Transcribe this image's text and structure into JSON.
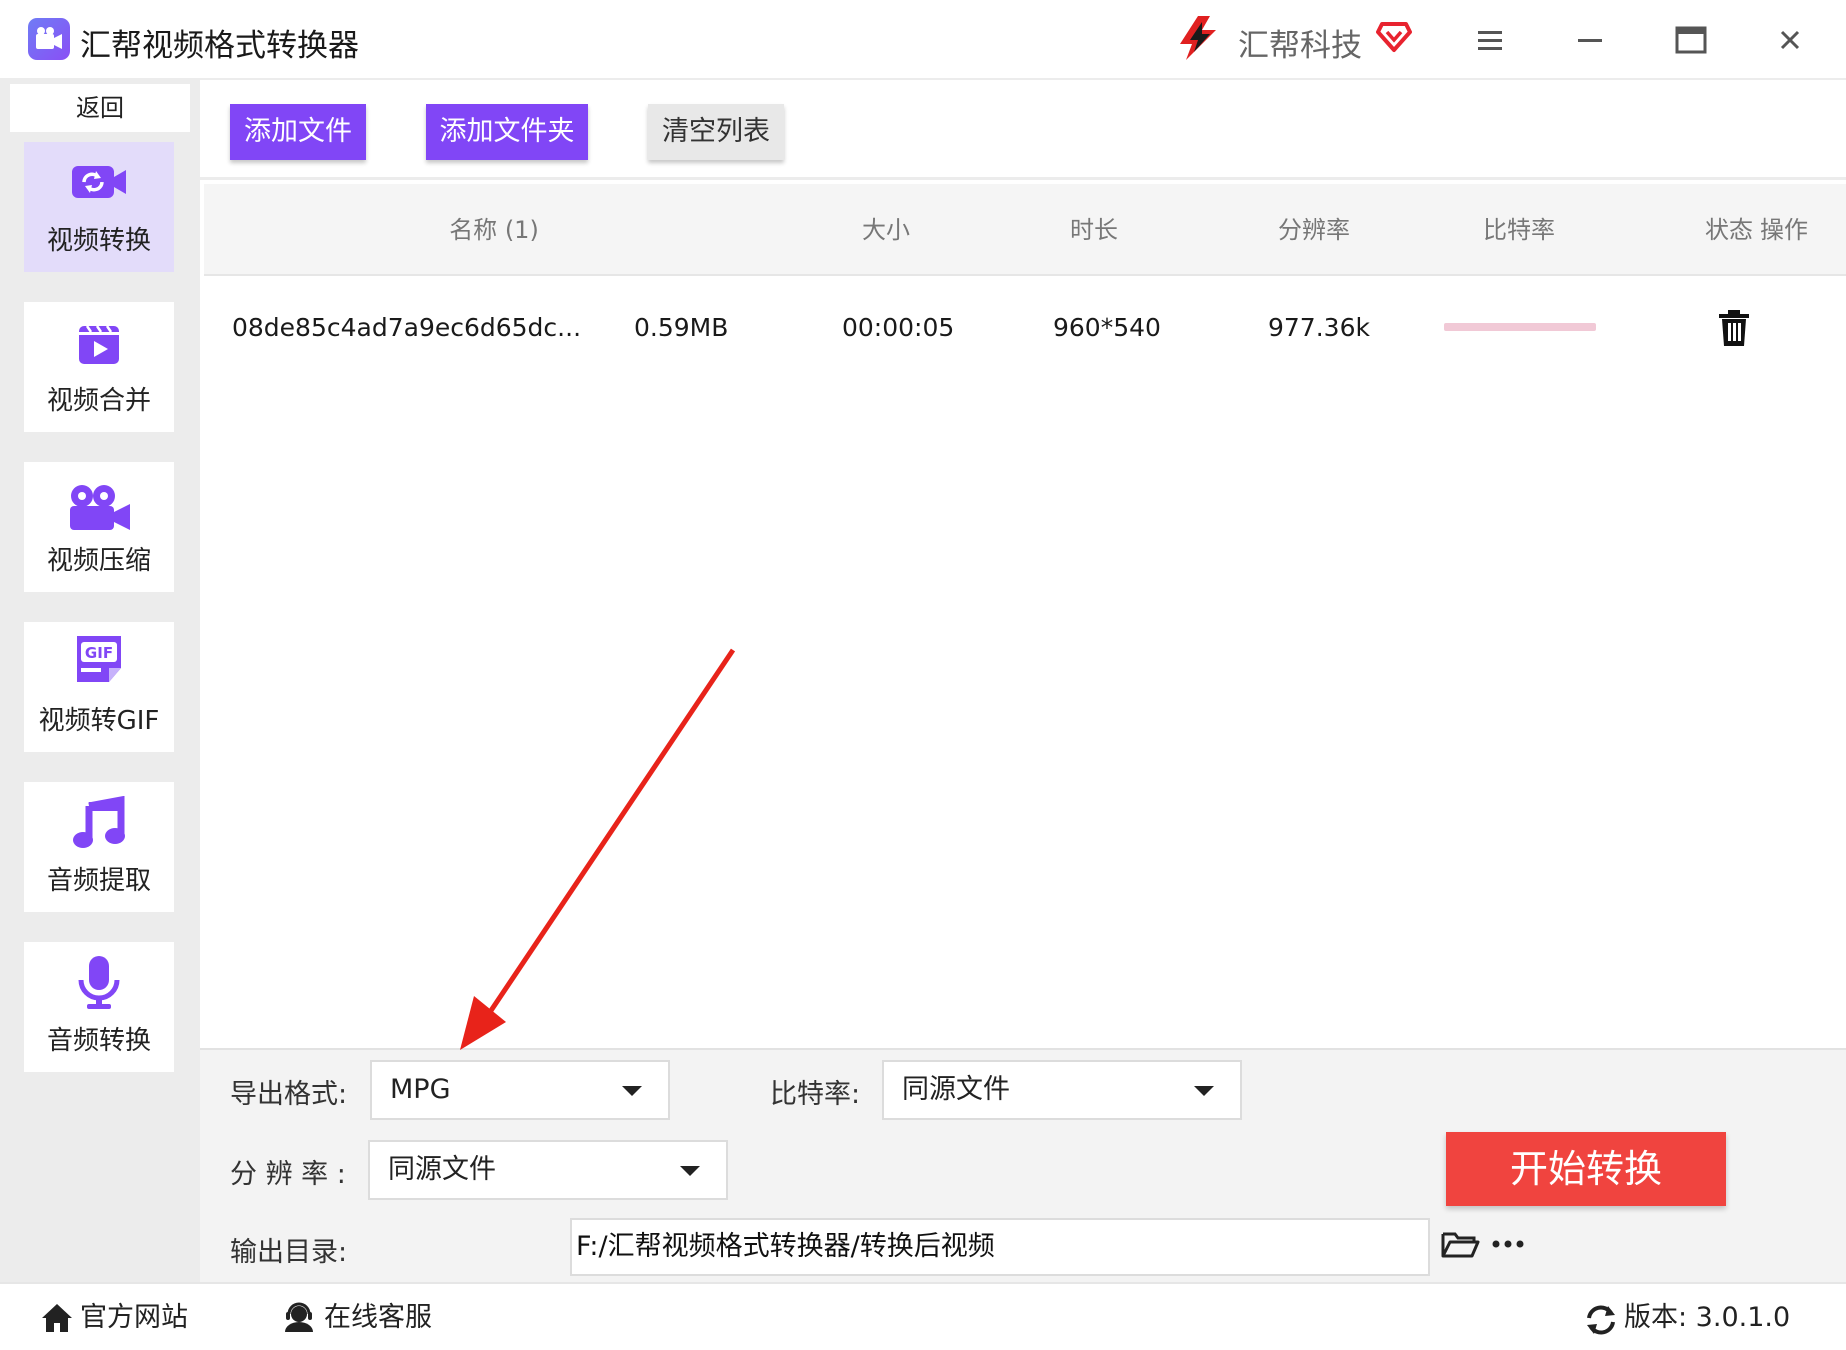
{
  "app": {
    "title": "汇帮视频格式转换器",
    "brand": "汇帮科技"
  },
  "sidebar": {
    "back_label": "返回",
    "items": [
      {
        "label": "视频转换",
        "icon": "video-convert-icon",
        "active": true
      },
      {
        "label": "视频合并",
        "icon": "video-merge-icon",
        "active": false
      },
      {
        "label": "视频压缩",
        "icon": "video-compress-icon",
        "active": false
      },
      {
        "label": "视频转GIF",
        "icon": "gif-icon",
        "active": false
      },
      {
        "label": "音频提取",
        "icon": "music-note-icon",
        "active": false
      },
      {
        "label": "音频转换",
        "icon": "microphone-icon",
        "active": false
      }
    ]
  },
  "toolbar": {
    "add_file": "添加文件",
    "add_folder": "添加文件夹",
    "clear_list": "清空列表"
  },
  "table": {
    "headers": [
      "名称 (1)",
      "大小",
      "时长",
      "分辨率",
      "比特率",
      "状态",
      "操作"
    ],
    "rows": [
      {
        "name": "08de85c4ad7a9ec6d65dc...",
        "size": "0.59MB",
        "duration": "00:00:05",
        "resolution": "960*540",
        "bitrate": "977.36k",
        "progress": 0
      }
    ]
  },
  "settings": {
    "format_label": "导出格式:",
    "format_value": "MPG",
    "bitrate_label": "比特率:",
    "bitrate_value": "同源文件",
    "resolution_label": "分 辨 率 :",
    "resolution_value": "同源文件",
    "output_label": "输出目录:",
    "output_path": "F:/汇帮视频格式转换器/转换后视频",
    "start_button": "开始转换"
  },
  "footer": {
    "website": "官方网站",
    "support": "在线客服",
    "version": "版本: 3.0.1.0"
  },
  "colors": {
    "accent": "#8146f6",
    "start": "#f0443f",
    "active_nav": "#e3dcfa",
    "annotation": "#e8231a"
  }
}
